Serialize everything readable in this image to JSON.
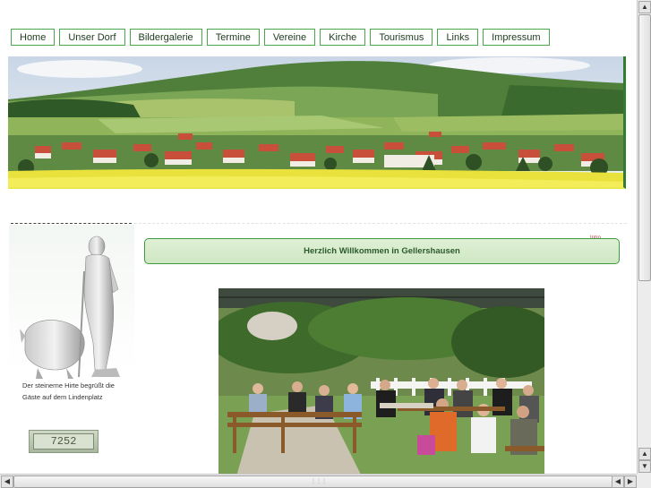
{
  "nav": [
    "Home",
    "Unser Dorf",
    "Bildergalerie",
    "Termine",
    "Vereine",
    "Kirche",
    "Tourismus",
    "Links",
    "Impressum"
  ],
  "welcome_text": "Herzlich Willkommen in Gellershausen",
  "tiny_link": "Intro",
  "statue_caption": "Der steinerne Hirte begrüßt die Gäste auf dem Lindenplatz",
  "counter_value": "7252",
  "icons": {
    "scroll_up": "arrow-up-icon",
    "scroll_down": "arrow-down-icon",
    "scroll_left": "arrow-left-icon",
    "scroll_right": "arrow-right-icon"
  },
  "colors": {
    "nav_border": "#4aa64a",
    "welcome_bg": "#dff0d6",
    "welcome_text": "#2b5a2b"
  }
}
